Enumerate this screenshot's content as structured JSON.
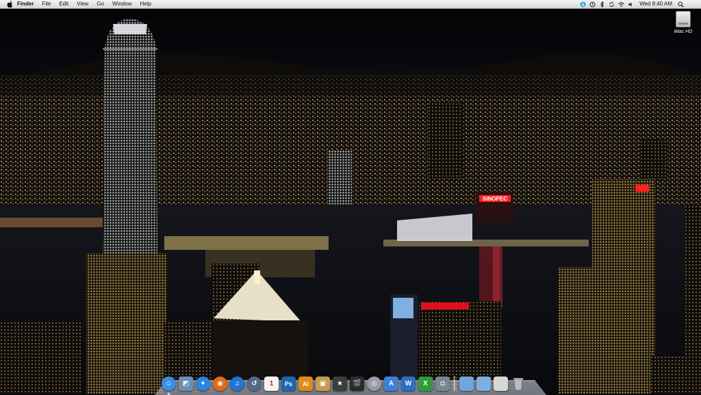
{
  "menubar": {
    "app_name": "Finder",
    "menus": [
      "File",
      "Edit",
      "View",
      "Go",
      "Window",
      "Help"
    ],
    "clock": "Wed 8:40 AM",
    "status_icons": [
      "skype-icon",
      "time-machine-icon",
      "bluetooth-icon",
      "sync-icon",
      "wifi-icon",
      "volume-icon"
    ]
  },
  "desktop": {
    "icons": [
      {
        "label": "iMac HD",
        "icon": "hard-drive-icon"
      }
    ],
    "wallpaper": "Hong Kong Victoria Harbour night skyline"
  },
  "dock": {
    "apps": [
      {
        "name": "finder-icon",
        "glyph": "☺",
        "color": "#3a8ee6"
      },
      {
        "name": "preview-icon",
        "glyph": "◩",
        "color": "#6b8fb8"
      },
      {
        "name": "safari-icon",
        "glyph": "✦",
        "color": "#2a86e0"
      },
      {
        "name": "firefox-icon",
        "glyph": "◉",
        "color": "#e26a1c"
      },
      {
        "name": "itunes-icon",
        "glyph": "♫",
        "color": "#1f74d6"
      },
      {
        "name": "time-machine-icon",
        "glyph": "↺",
        "color": "#516a8a"
      },
      {
        "name": "ical-icon",
        "glyph": "1",
        "color": "#f4f4f4"
      },
      {
        "name": "photoshop-icon",
        "glyph": "Ps",
        "color": "#1c67b0"
      },
      {
        "name": "illustrator-icon",
        "glyph": "Ai",
        "color": "#e08a1a"
      },
      {
        "name": "iphoto-icon",
        "glyph": "▣",
        "color": "#c89a50"
      },
      {
        "name": "imovie-icon",
        "glyph": "★",
        "color": "#3d3d3d"
      },
      {
        "name": "final-cut-icon",
        "glyph": "🎬",
        "color": "#2b2b2b"
      },
      {
        "name": "dvd-player-icon",
        "glyph": "◎",
        "color": "#9a9aa8"
      },
      {
        "name": "app-store-icon",
        "glyph": "A",
        "color": "#3f7fd8"
      },
      {
        "name": "word-icon",
        "glyph": "W",
        "color": "#2b6fc6"
      },
      {
        "name": "excel-icon",
        "glyph": "X",
        "color": "#2f9c3a"
      },
      {
        "name": "screenshot-icon",
        "glyph": "◘",
        "color": "#7a8595"
      }
    ],
    "stacks": [
      {
        "name": "applications-folder-icon",
        "color": "#6fa6dc"
      },
      {
        "name": "documents-folder-icon",
        "color": "#7caee0"
      },
      {
        "name": "downloads-stack-icon",
        "color": "#d8d8d8"
      },
      {
        "name": "trash-icon",
        "color": "#a8a8a8"
      }
    ]
  },
  "colors": {
    "menubar_bg": "#e2e2e2",
    "sinopec_sign": "#ff2020",
    "hsbc_sign": "#e0101a"
  },
  "signs": [
    "SINOPEC"
  ]
}
